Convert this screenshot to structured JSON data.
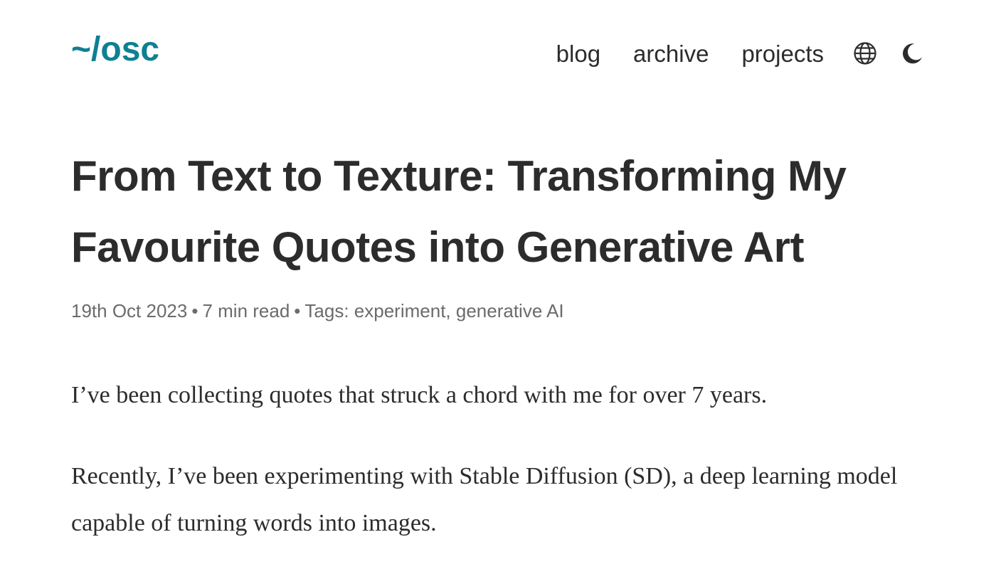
{
  "header": {
    "logo": "~/osc",
    "nav": [
      {
        "label": "blog"
      },
      {
        "label": "archive"
      },
      {
        "label": "projects"
      }
    ],
    "icons": [
      "globe-icon",
      "moon-icon"
    ]
  },
  "article": {
    "title": "From Text to Texture: Transforming My Favourite Quotes into Generative Art",
    "date": "19th Oct 2023",
    "read_time": "7 min read",
    "tags_label": "Tags:",
    "tags": "experiment, generative AI",
    "separator": "•",
    "paragraphs": [
      "I’ve been collecting quotes that struck a chord with me for over 7 years.",
      "Recently, I’ve been experimenting with Stable Diffusion (SD), a deep learning model capable of turning words into images."
    ]
  },
  "colors": {
    "accent": "#0f7f93",
    "text": "#2c2c2c",
    "muted": "#6b6b6b",
    "background": "#ffffff"
  }
}
